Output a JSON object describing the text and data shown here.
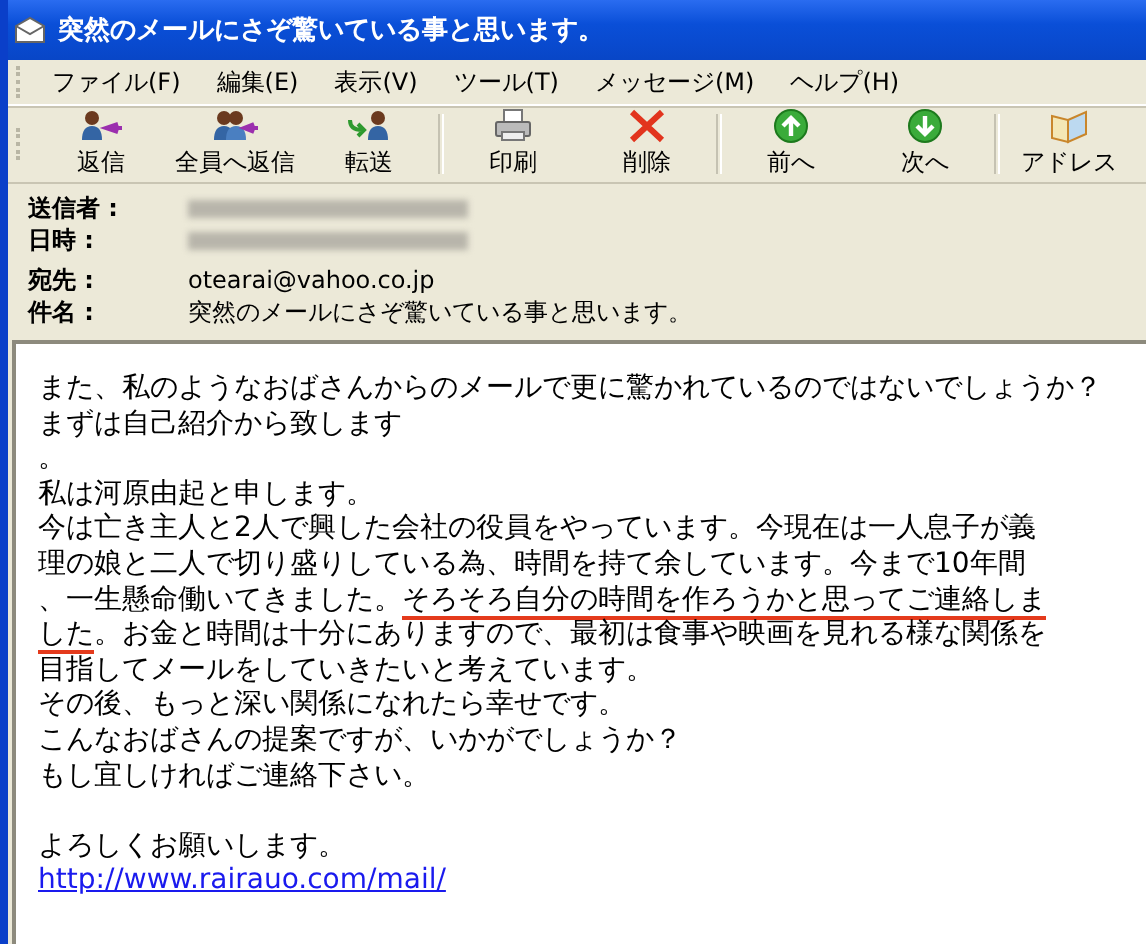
{
  "window": {
    "title": "突然のメールにさぞ驚いている事と思います。"
  },
  "menu": [
    {
      "label": "ファイル(F)"
    },
    {
      "label": "編集(E)"
    },
    {
      "label": "表示(V)"
    },
    {
      "label": "ツール(T)"
    },
    {
      "label": "メッセージ(M)"
    },
    {
      "label": "ヘルプ(H)"
    }
  ],
  "toolbar": [
    [
      {
        "label": "返信",
        "kind": "reply"
      },
      {
        "label": "全員へ返信",
        "kind": "reply_all"
      },
      {
        "label": "転送",
        "kind": "forward"
      }
    ],
    [
      {
        "label": "印刷",
        "kind": "print"
      },
      {
        "label": "削除",
        "kind": "delete"
      }
    ],
    [
      {
        "label": "前へ",
        "kind": "previous"
      },
      {
        "label": "次へ",
        "kind": "next"
      }
    ],
    [
      {
        "label": "アドレス",
        "kind": "address_book"
      }
    ]
  ],
  "headers": [
    {
      "label": "送信者 :",
      "kind": "redacted"
    },
    {
      "label": "日時 :",
      "kind": "redacted"
    },
    {
      "label": "宛先 :",
      "kind": "text",
      "value": "otearai@vahoo.co.jp"
    },
    {
      "label": "件名 :",
      "kind": "text",
      "value": "突然のメールにさぞ驚いている事と思います。"
    }
  ],
  "body": [
    {
      "kind": "text",
      "segments": [
        {
          "text": "また、私のようなおばさんからのメールで更に驚かれているのではないでしょうか？",
          "underlined": false
        }
      ]
    },
    {
      "kind": "text",
      "segments": [
        {
          "text": "まずは自己紹介から致します",
          "underlined": false
        }
      ]
    },
    {
      "kind": "text",
      "segments": [
        {
          "text": "。",
          "underlined": false
        }
      ]
    },
    {
      "kind": "text",
      "segments": [
        {
          "text": "私は河原由起と申します。",
          "underlined": false
        }
      ]
    },
    {
      "kind": "text",
      "segments": [
        {
          "text": "今は亡き主人と2人で興した会社の役員をやっています。今現在は一人息子が義",
          "underlined": false
        }
      ]
    },
    {
      "kind": "text",
      "segments": [
        {
          "text": "理の娘と二人で切り盛りしている為、時間を持て余しています。今まで10年間",
          "underlined": false
        }
      ]
    },
    {
      "kind": "text",
      "segments": [
        {
          "text": "、一生懸命働いてきました。",
          "underlined": false
        },
        {
          "text": "そろそろ自分の時間を作ろうかと思ってご連絡しま",
          "underlined": true
        }
      ]
    },
    {
      "kind": "text",
      "segments": [
        {
          "text": "した",
          "underlined": true
        },
        {
          "text": "。お金と時間は十分にありますので、最初は食事や映画を見れる様な関係を",
          "underlined": false
        }
      ]
    },
    {
      "kind": "text",
      "segments": [
        {
          "text": "目指してメールをしていきたいと考えています。",
          "underlined": false
        }
      ]
    },
    {
      "kind": "text",
      "segments": [
        {
          "text": "その後、もっと深い関係になれたら幸せです。",
          "underlined": false
        }
      ]
    },
    {
      "kind": "text",
      "segments": [
        {
          "text": "こんなおばさんの提案ですが、いかがでしょうか？",
          "underlined": false
        }
      ]
    },
    {
      "kind": "text",
      "segments": [
        {
          "text": "もし宜しければご連絡下さい。",
          "underlined": false
        }
      ]
    },
    {
      "kind": "blank"
    },
    {
      "kind": "text",
      "segments": [
        {
          "text": "よろしくお願いします。",
          "underlined": false
        }
      ]
    },
    {
      "kind": "link",
      "segments": [
        {
          "text": "http://www.rairauo.com/mail/",
          "underlined": false
        }
      ]
    }
  ]
}
